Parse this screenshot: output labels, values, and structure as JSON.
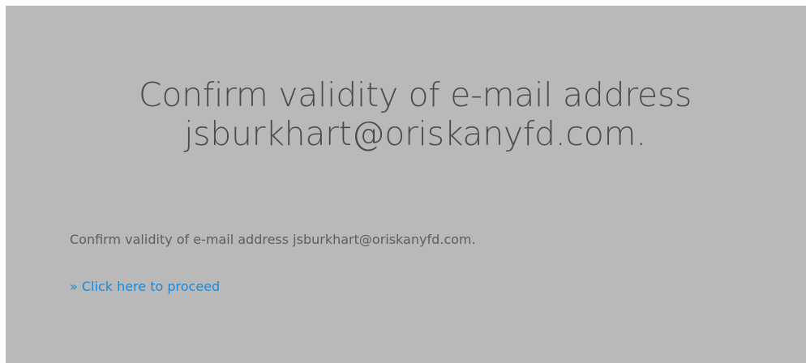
{
  "heading": {
    "line1": "Confirm validity of e-mail address",
    "line2": "jsburkhart@oriskanyfd.com."
  },
  "message": "Confirm validity of e-mail address jsburkhart@oriskanyfd.com.",
  "proceed_link": {
    "label": "» Click here to proceed"
  },
  "colors": {
    "panel_background": "#b9b9b9",
    "heading_text": "#4b4b4b",
    "body_text": "#5e5e5e",
    "link": "#1e88d6"
  }
}
